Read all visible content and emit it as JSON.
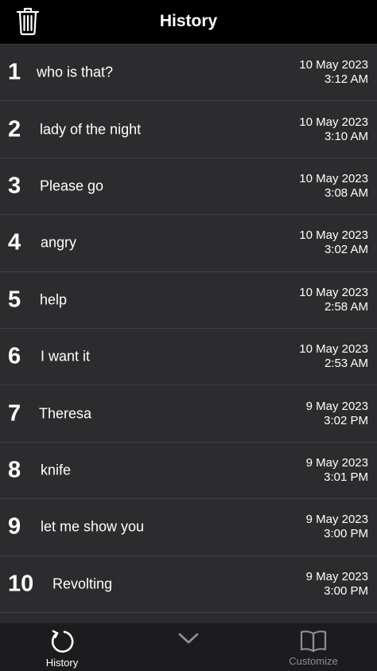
{
  "header": {
    "title": "History",
    "trash_icon": "trash-icon"
  },
  "history": [
    {
      "num": "1",
      "text": "who is that?",
      "date": "10 May 2023",
      "time": "3:12 AM"
    },
    {
      "num": "2",
      "text": "lady of the night",
      "date": "10 May 2023",
      "time": "3:10 AM"
    },
    {
      "num": "3",
      "text": "Please go",
      "date": "10 May 2023",
      "time": "3:08 AM"
    },
    {
      "num": "4",
      "text": "angry",
      "date": "10 May 2023",
      "time": "3:02 AM"
    },
    {
      "num": "5",
      "text": "help",
      "date": "10 May 2023",
      "time": "2:58 AM"
    },
    {
      "num": "6",
      "text": "I want it",
      "date": "10 May 2023",
      "time": "2:53 AM"
    },
    {
      "num": "7",
      "text": "Theresa",
      "date": "9 May 2023",
      "time": "3:02 PM"
    },
    {
      "num": "8",
      "text": "knife",
      "date": "9 May 2023",
      "time": "3:01 PM"
    },
    {
      "num": "9",
      "text": "let me show you",
      "date": "9 May 2023",
      "time": "3:00 PM"
    },
    {
      "num": "10",
      "text": "Revolting",
      "date": "9 May 2023",
      "time": "3:00 PM"
    }
  ],
  "tabbar": {
    "history_label": "History",
    "history_icon": "refresh-icon",
    "center_icon": "chevron-down-icon",
    "customize_label": "Customize",
    "customize_icon": "book-icon"
  },
  "colors": {
    "background": "#000000",
    "row_background": "#2c2c2e",
    "tabbar_background": "#1c1c1e",
    "active_tab": "#ffffff",
    "inactive_tab": "#8e8e93"
  }
}
